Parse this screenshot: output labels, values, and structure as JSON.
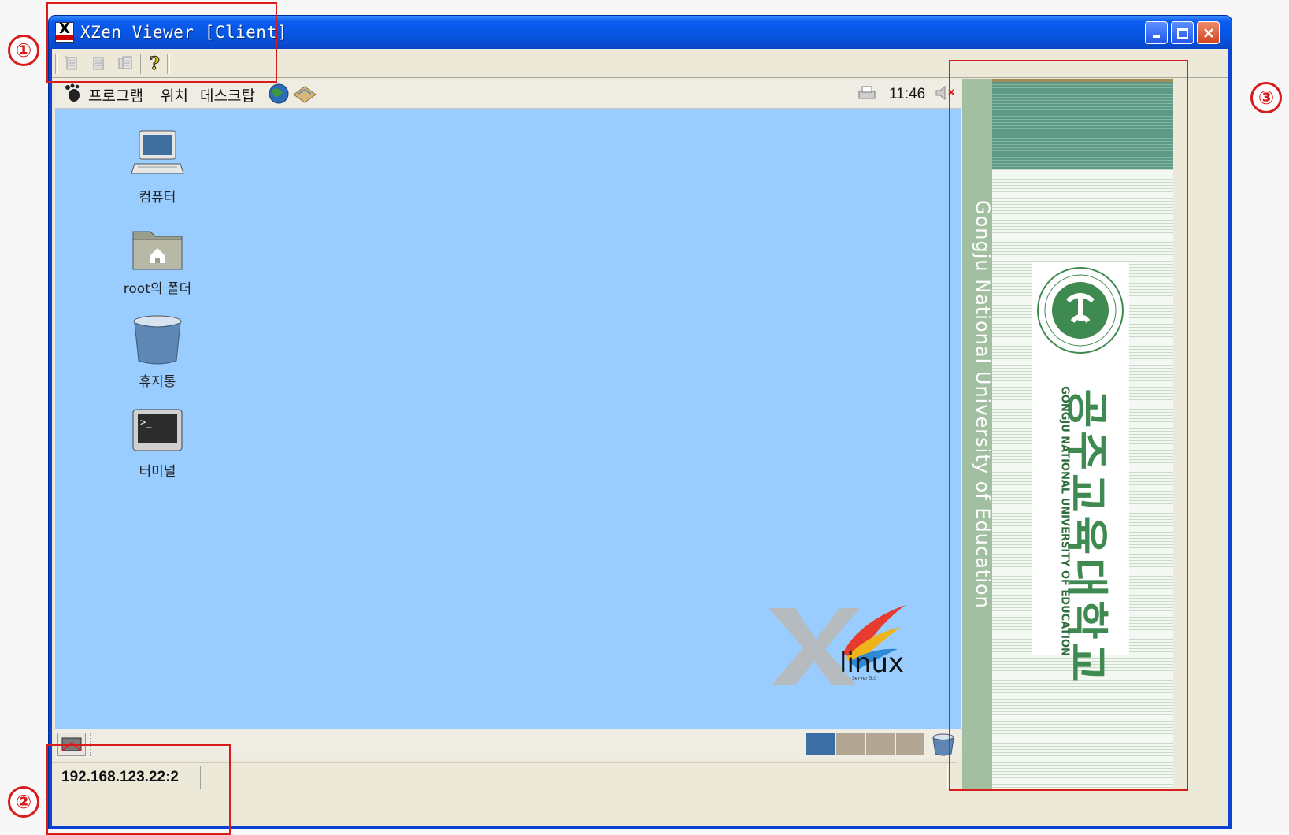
{
  "window": {
    "title": "XZen Viewer [Client]",
    "logo_text": "X"
  },
  "toolbar": {
    "buttons": [
      {
        "icon": "doc-new-icon"
      },
      {
        "icon": "doc-copy-icon"
      },
      {
        "icon": "doc-paste-icon"
      },
      {
        "icon": "help-icon"
      }
    ]
  },
  "desktop": {
    "top_panel": {
      "menus": [
        "프로그램",
        "위치",
        "데스크탑"
      ],
      "clock": "11:46"
    },
    "icons": [
      {
        "label": "컴퓨터",
        "icon": "computer-icon"
      },
      {
        "label": "root의 폴더",
        "icon": "home-folder-icon"
      },
      {
        "label": "휴지통",
        "icon": "trash-icon"
      },
      {
        "label": "터미널",
        "icon": "terminal-icon"
      }
    ],
    "brand_logo": {
      "text": "linux",
      "sub": "Server 5.0"
    },
    "workspaces": [
      {
        "active": true,
        "color": "#3b6ea5"
      },
      {
        "active": false,
        "color": "#b4a694"
      },
      {
        "active": false,
        "color": "#b4a694"
      },
      {
        "active": false,
        "color": "#b4a694"
      }
    ]
  },
  "statusbar": {
    "host": "192.168.123.22:2"
  },
  "banner": {
    "english_vertical": "Gongju National University of Education",
    "korean_name": "공주교육대학교",
    "english_name": "GONGJU NATIONAL UNIVERSITY OF EDUCATION",
    "seal_text": "GONGJU NATIONAL UNIVERSITY OF EDUCATION"
  },
  "callouts": [
    "①",
    "②",
    "③"
  ],
  "colors": {
    "annotation": "#d81b1b",
    "desktop_bg": "#99ccff",
    "title_blue": "#0a5cf1"
  }
}
